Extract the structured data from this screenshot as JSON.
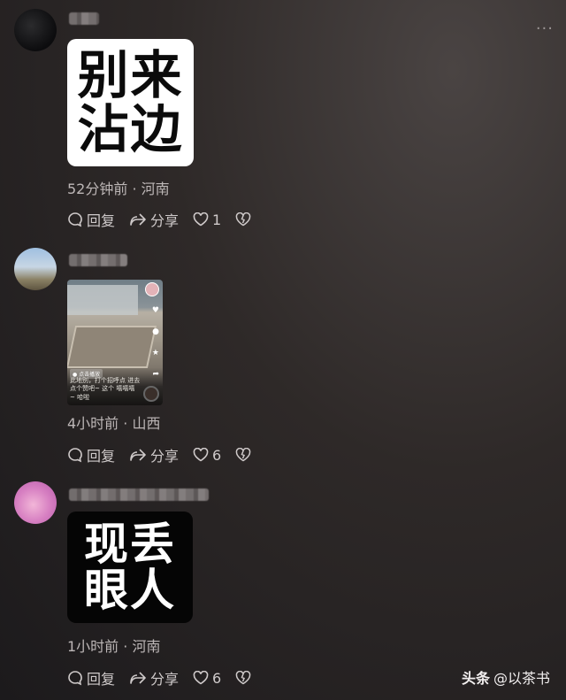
{
  "comments": [
    {
      "sticker_lines": [
        "别来",
        "沾边"
      ],
      "meta": "52分钟前 · 河南",
      "reply_label": "回复",
      "share_label": "分享",
      "like_count": "1"
    },
    {
      "video": {
        "tag": "● 点击播放",
        "caption": "此地别，打个招呼点 进去点个赞吧~ 这个 嘻嘻嘻 ~ 哈啦"
      },
      "meta": "4小时前 · 山西",
      "reply_label": "回复",
      "share_label": "分享",
      "like_count": "6"
    },
    {
      "sticker_lines": [
        "现丢",
        "眼人"
      ],
      "meta": "1小时前 · 河南",
      "reply_label": "回复",
      "share_label": "分享",
      "like_count": "6"
    }
  ],
  "watermark": {
    "brand": "头条",
    "handle": "@以茶书"
  },
  "more_menu_icon": "more-dots-icon",
  "icons": [
    "comment-bubble-icon",
    "share-arrow-icon",
    "heart-icon",
    "broken-heart-icon"
  ]
}
